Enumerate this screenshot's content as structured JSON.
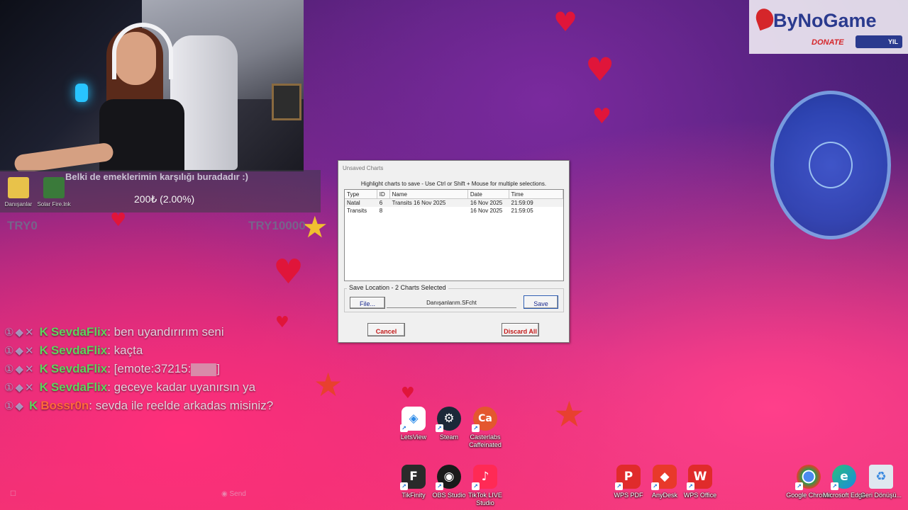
{
  "webcam": {
    "donation_message": "Belki de emeklerimin karşılığı buradadır :)",
    "donation_amount": "200₺ (2.00%)",
    "progress_min": "TRY0",
    "progress_max": "TRY10000",
    "small_icons": [
      {
        "label": "Danışanlar",
        "color": "#e8c24a"
      },
      {
        "label": "Solar Fire.lnk",
        "color": "#3a7a3a"
      }
    ]
  },
  "chat": {
    "messages": [
      {
        "badges": "①◆✕",
        "kick": "K",
        "user": "SevdaFlix",
        "text": ": ben uyandırırım seni"
      },
      {
        "badges": "①◆✕",
        "kick": "K",
        "user": "SevdaFlix",
        "text": ": kaçta"
      },
      {
        "badges": "①◆✕",
        "kick": "K",
        "user": "SevdaFlix",
        "text": ": [emote:37215:",
        "emote": true,
        "text_after": "]"
      },
      {
        "badges": "①◆✕",
        "kick": "K",
        "user": "SevdaFlix",
        "text": ": geceye kadar uyanırsın ya"
      },
      {
        "badges": "①◆",
        "kick": "K",
        "user": "Bossr0n",
        "text": ": sevda ile reelde arkadas misiniz?"
      }
    ],
    "send_label": "Send"
  },
  "sponsor": {
    "logo_text": "ByNoGame",
    "donate_label": "DONATE",
    "pill_label": "YIL"
  },
  "dialog": {
    "title": "Unsaved Charts",
    "hint": "Highlight charts to save  -  Use Ctrl or Shift + Mouse for multiple selections.",
    "columns": [
      "Type",
      "ID",
      "Name",
      "Date",
      "Time"
    ],
    "rows": [
      {
        "type": "Natal",
        "id": "6",
        "name": "Transits 16 Nov 2025",
        "date": "16 Nov 2025",
        "time": "21:59:09"
      },
      {
        "type": "Transits",
        "id": "8",
        "name": "",
        "date": "16 Nov 2025",
        "time": "21:59:05"
      }
    ],
    "save_location_label": "Save Location  - 2 Charts Selected",
    "file_button": "File...",
    "file_path": "Danışanlarım.SFcht",
    "save_button": "Save",
    "cancel_button": "Cancel",
    "discard_button": "Discard All"
  },
  "desktop_icons": {
    "row1": [
      {
        "label": "LetsView",
        "icon": "letsview-icon",
        "glyph": "◈",
        "color": "#ffffff",
        "fg": "#2a8ae8"
      },
      {
        "label": "Steam",
        "icon": "steam-icon",
        "glyph": "⚙",
        "color": "#1b2838",
        "fg": "#ffffff"
      },
      {
        "label": "Casterlabs Caffeinated",
        "icon": "casterlabs-icon",
        "glyph": "Ca",
        "color": "#e4572e",
        "fg": "#ffffff"
      }
    ],
    "row2": [
      {
        "label": "TikFinity",
        "icon": "tikfinity-icon",
        "glyph": "F",
        "color": "#2a2a2a",
        "fg": "#ffffff"
      },
      {
        "label": "OBS Studio",
        "icon": "obs-icon",
        "glyph": "◉",
        "color": "#1a1a1a",
        "fg": "#ffffff"
      },
      {
        "label": "TikTok LIVE Studio",
        "icon": "tiktok-icon",
        "glyph": "♪",
        "color": "#ff2a55",
        "fg": "#ffffff"
      }
    ],
    "right": [
      {
        "label": "WPS PDF",
        "icon": "wps-pdf-icon",
        "glyph": "P",
        "color": "#e02b2b",
        "fg": "#ffffff"
      },
      {
        "label": "AnyDesk",
        "icon": "anydesk-icon",
        "glyph": "◆",
        "color": "#e8392a",
        "fg": "#ffffff"
      },
      {
        "label": "WPS Office",
        "icon": "wps-office-icon",
        "glyph": "W",
        "color": "#e02b2b",
        "fg": "#ffffff"
      }
    ],
    "far_right": [
      {
        "label": "Google Chrome",
        "icon": "chrome-icon",
        "glyph": "◎",
        "color": "#ffffff",
        "fg": "#2a8a3a"
      },
      {
        "label": "Microsoft Edge",
        "icon": "edge-icon",
        "glyph": "e",
        "color": "#1a8ae0",
        "fg": "#ffffff"
      },
      {
        "label": "Geri Dönüşü...",
        "icon": "recycle-bin-icon",
        "glyph": "♻",
        "color": "#dfe8f0",
        "fg": "#5a6a7a"
      }
    ]
  }
}
